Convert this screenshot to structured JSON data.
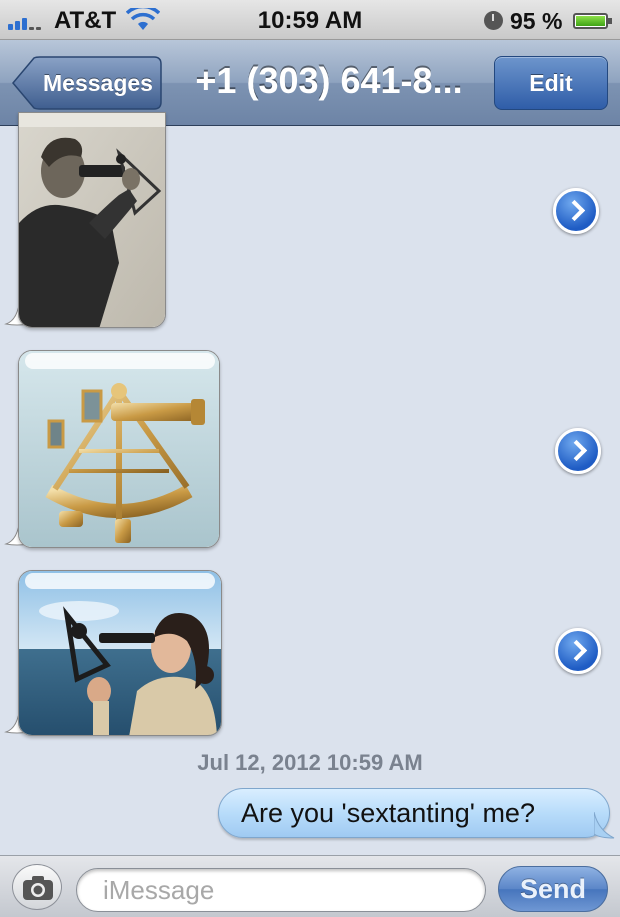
{
  "status_bar": {
    "carrier": "AT&T",
    "time": "10:59 AM",
    "battery": "95 %",
    "battery_level": 0.95
  },
  "nav": {
    "back_label": "Messages",
    "title": "+1 (303) 641-8...",
    "edit_label": "Edit"
  },
  "messages": [
    {
      "kind": "image",
      "direction": "incoming",
      "subject": "man-using-sextant-photo"
    },
    {
      "kind": "image",
      "direction": "incoming",
      "subject": "brass-sextant-photo"
    },
    {
      "kind": "image",
      "direction": "incoming",
      "subject": "woman-using-sextant-at-sea-photo"
    }
  ],
  "timestamp": "Jul 12, 2012 10:59 AM",
  "outgoing_text": "Are you 'sextanting' me?",
  "input": {
    "placeholder": "iMessage",
    "send_label": "Send"
  },
  "colors": {
    "background": "#dbe2ed",
    "nav_bar": "#8ea3bf",
    "send_button": "#5b86c8",
    "outgoing_bubble": "#b8dcfa"
  }
}
